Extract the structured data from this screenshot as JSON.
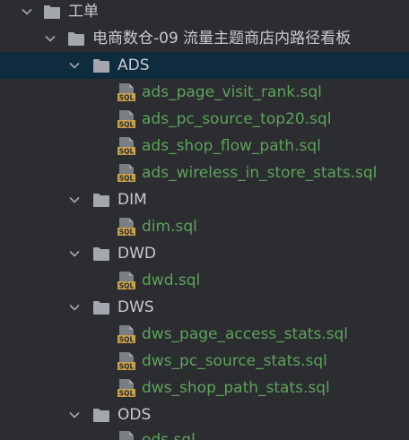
{
  "colors": {
    "background": "#2b2d30",
    "selected_row": "#0f2c3f",
    "folder_text": "#c8cbd0",
    "file_text": "#5ea25c",
    "folder_icon": "#a4a7ad",
    "sql_badge": "#c9a14a"
  },
  "tree": {
    "root": {
      "label": "工单",
      "icon": "folder-icon",
      "expanded": true
    },
    "project": {
      "label": "电商数仓-09 流量主题商店内路径看板",
      "icon": "folder-icon",
      "expanded": true
    },
    "ads": {
      "label": "ADS",
      "icon": "folder-icon",
      "expanded": true,
      "selected": true,
      "files": [
        {
          "label": "ads_page_visit_rank.sql",
          "icon": "sql-file-icon"
        },
        {
          "label": "ads_pc_source_top20.sql",
          "icon": "sql-file-icon"
        },
        {
          "label": "ads_shop_flow_path.sql",
          "icon": "sql-file-icon"
        },
        {
          "label": "ads_wireless_in_store_stats.sql",
          "icon": "sql-file-icon"
        }
      ]
    },
    "dim": {
      "label": "DIM",
      "icon": "folder-icon",
      "expanded": true,
      "files": [
        {
          "label": "dim.sql",
          "icon": "sql-file-icon"
        }
      ]
    },
    "dwd": {
      "label": "DWD",
      "icon": "folder-icon",
      "expanded": true,
      "files": [
        {
          "label": "dwd.sql",
          "icon": "sql-file-icon"
        }
      ]
    },
    "dws": {
      "label": "DWS",
      "icon": "folder-icon",
      "expanded": true,
      "files": [
        {
          "label": "dws_page_access_stats.sql",
          "icon": "sql-file-icon"
        },
        {
          "label": "dws_pc_source_stats.sql",
          "icon": "sql-file-icon"
        },
        {
          "label": "dws_shop_path_stats.sql",
          "icon": "sql-file-icon"
        }
      ]
    },
    "ods": {
      "label": "ODS",
      "icon": "folder-icon",
      "expanded": true,
      "files": [
        {
          "label": "ods.sql",
          "icon": "sql-file-icon"
        }
      ]
    }
  }
}
